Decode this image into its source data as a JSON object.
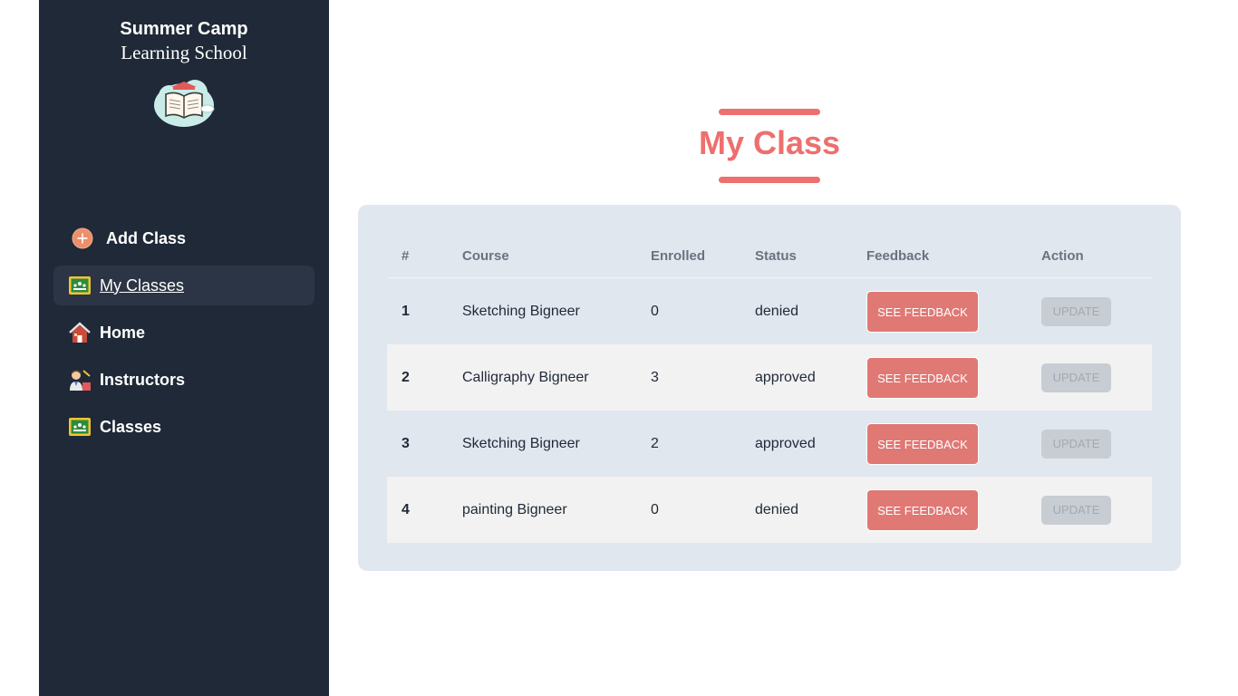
{
  "brand": {
    "line1": "Summer Camp",
    "line2": "Learning School",
    "logo_icon": "book-cloud-logo-icon"
  },
  "sidebar": {
    "items": [
      {
        "label": "Add Class",
        "icon": "plus-circle-icon",
        "active": false
      },
      {
        "label": "My Classes",
        "icon": "classroom-board-icon",
        "active": true
      },
      {
        "label": "Home",
        "icon": "house-icon",
        "active": false
      },
      {
        "label": "Instructors",
        "icon": "teacher-icon",
        "active": false
      },
      {
        "label": "Classes",
        "icon": "classroom-board-icon",
        "active": false
      }
    ]
  },
  "main": {
    "title": "My Class",
    "table": {
      "headers": [
        "#",
        "Course",
        "Enrolled",
        "Status",
        "Feedback",
        "Action"
      ],
      "rows": [
        {
          "num": "1",
          "course": "Sketching Bigneer",
          "enrolled": "0",
          "status": "denied",
          "feedback": "SEE FEEDBACK",
          "action": "UPDATE"
        },
        {
          "num": "2",
          "course": "Calligraphy Bigneer",
          "enrolled": "3",
          "status": "approved",
          "feedback": "SEE FEEDBACK",
          "action": "UPDATE"
        },
        {
          "num": "3",
          "course": "Sketching Bigneer",
          "enrolled": "2",
          "status": "approved",
          "feedback": "SEE FEEDBACK",
          "action": "UPDATE"
        },
        {
          "num": "4",
          "course": "painting Bigneer",
          "enrolled": "0",
          "status": "denied",
          "feedback": "SEE FEEDBACK",
          "action": "UPDATE"
        }
      ]
    }
  },
  "colors": {
    "sidebar_bg": "#1f2937",
    "accent": "#ee6f6f",
    "feedback_button": "#e07874",
    "panel_bg": "#e1e7ef",
    "update_disabled": "#c8ccd3"
  }
}
